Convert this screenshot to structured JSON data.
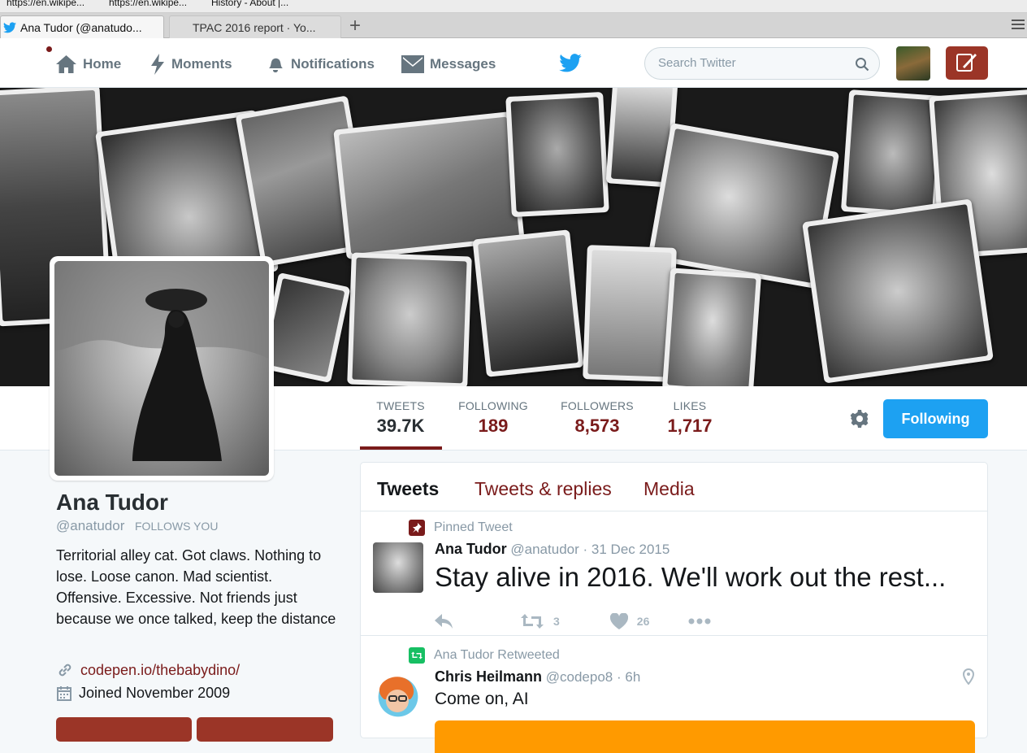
{
  "browser": {
    "bookmarks": [
      "https://en.wikipe...",
      "https://en.wikipe...",
      "History - About |..."
    ],
    "tabs": [
      {
        "title": "Ana Tudor (@anatudo...",
        "active": true
      },
      {
        "title": "TPAC 2016 report · Yo...",
        "active": false
      }
    ],
    "new_tab": "+"
  },
  "nav": {
    "home": "Home",
    "moments": "Moments",
    "notifications": "Notifications",
    "messages": "Messages",
    "search_placeholder": "Search Twitter"
  },
  "stats": [
    {
      "label": "TWEETS",
      "value": "39.7K"
    },
    {
      "label": "FOLLOWING",
      "value": "189"
    },
    {
      "label": "FOLLOWERS",
      "value": "8,573"
    },
    {
      "label": "LIKES",
      "value": "1,717"
    }
  ],
  "follow_button": "Following",
  "profile": {
    "name": "Ana Tudor",
    "handle": "@anatudor",
    "follows_you": "FOLLOWS YOU",
    "bio": "Territorial alley cat. Got claws. Nothing to lose. Loose canon. Mad scientist. Offensive. Excessive. Not friends just because we once talked, keep the distance",
    "link": "codepen.io/thebabydino/",
    "joined": "Joined November 2009"
  },
  "timeline": {
    "tabs": [
      "Tweets",
      "Tweets & replies",
      "Media"
    ],
    "tweets": [
      {
        "context": "Pinned Tweet",
        "name": "Ana Tudor",
        "handle": "@anatudor",
        "time": "31 Dec 2015",
        "text": "Stay alive in 2016. We'll work out the rest...",
        "retweets": "3",
        "likes": "26"
      },
      {
        "context": "Ana Tudor Retweeted",
        "name": "Chris Heilmann",
        "handle": "@codepo8",
        "time": "6h",
        "text": "Come on, AI"
      }
    ]
  },
  "colors": {
    "brand": "#1da1f2",
    "theme": "#7a1b1b",
    "retweet_green": "#17bf63"
  }
}
